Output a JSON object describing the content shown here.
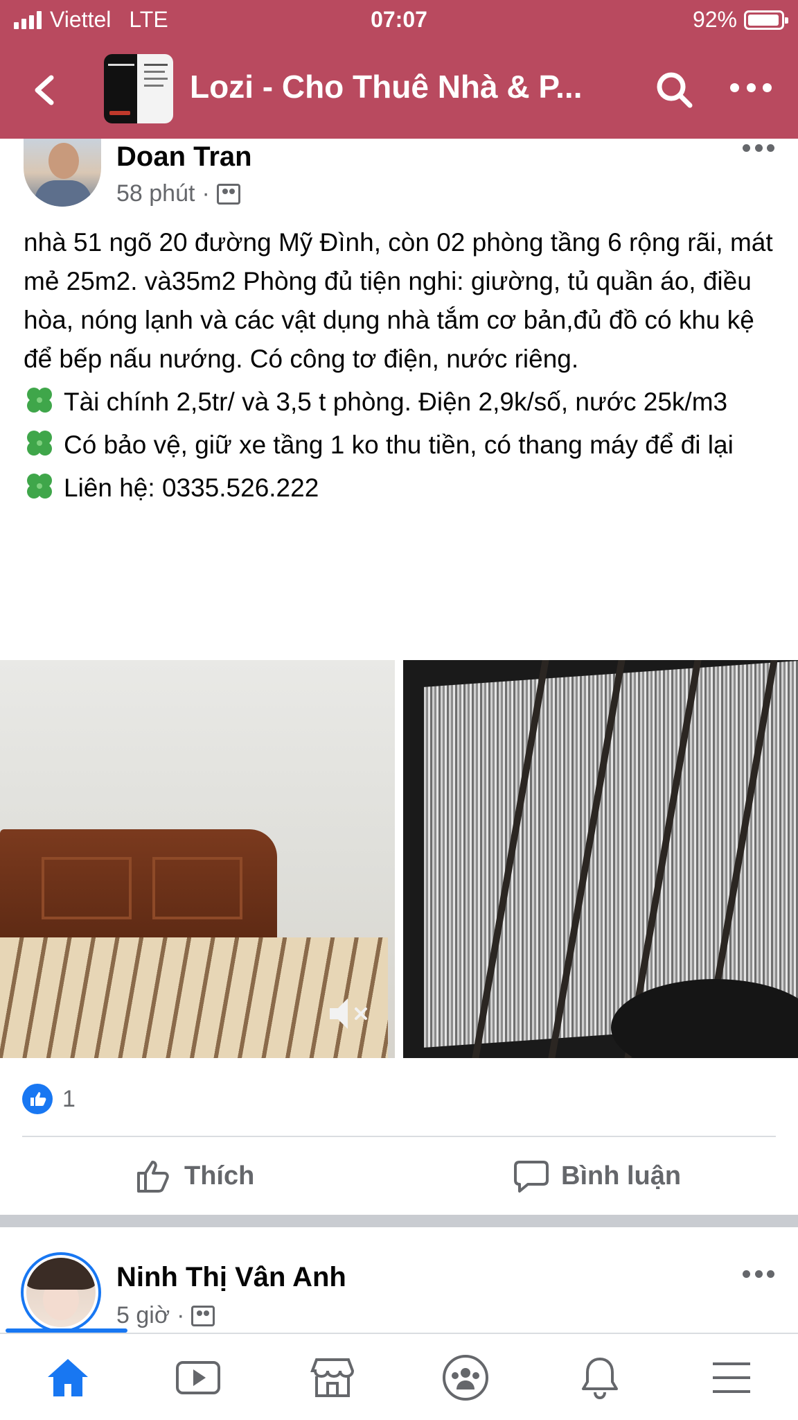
{
  "status_bar": {
    "carrier": "Viettel",
    "network": "LTE",
    "time": "07:07",
    "battery": "92%"
  },
  "header": {
    "title": "Lozi - Cho Thuê Nhà & P...",
    "icons": [
      "back-icon",
      "search-icon",
      "more-icon"
    ],
    "color": "#b94a5f"
  },
  "post1": {
    "author": "Doan Tran",
    "time": "58 phút",
    "separator": "·",
    "body": {
      "paragraph": "nhà 51 ngõ 20 đường Mỹ Đình, còn 02 phòng  tầng 6 rộng rãi, mát mẻ 25m2. và35m2 Phòng đủ tiện nghi: giường, tủ quần áo, điều hòa, nóng lạnh và các vật dụng nhà tắm cơ bản,đủ đồ có khu kệ để bếp nấu nướng. Có công tơ điện, nước riêng.",
      "bullet1": "Tài chính 2,5tr/ và 3,5 t  phòng. Điện 2,9k/số, nước 25k/m3",
      "bullet2": "Có bảo vệ, giữ xe tầng 1 ko thu tiền, có thang máy để đi lại",
      "bullet3": "Liên hệ: 0335.526.222"
    },
    "reaction_count": "1",
    "actions": {
      "like": "Thích",
      "comment": "Bình luận"
    }
  },
  "post2": {
    "author": "Ninh Thị Vân Anh",
    "time": "5 giờ",
    "separator": "·"
  },
  "bottom_nav": {
    "items": [
      "home-icon",
      "watch-icon",
      "marketplace-icon",
      "groups-icon",
      "notifications-icon",
      "menu-icon"
    ],
    "active_color": "#1877f2"
  }
}
